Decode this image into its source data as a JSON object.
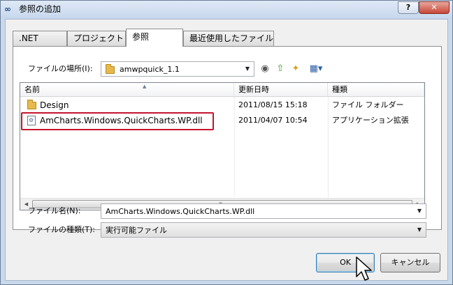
{
  "window": {
    "title": "参照の追加",
    "help_label": "?",
    "close_label": "✕"
  },
  "tabs": [
    {
      "label": ".NET",
      "active": false
    },
    {
      "label": "プロジェクト",
      "active": false
    },
    {
      "label": "参照",
      "active": true
    },
    {
      "label": "最近使用したファイル",
      "active": false
    }
  ],
  "location": {
    "label": "ファイルの場所(I):",
    "value": "amwpquick_1.1"
  },
  "toolbar_icons": [
    "back-icon",
    "up-folder-icon",
    "new-folder-icon",
    "view-menu-icon"
  ],
  "file_list": {
    "columns": [
      "名前",
      "更新日時",
      "種類"
    ],
    "rows": [
      {
        "name": "Design",
        "modified": "2011/08/15 15:18",
        "type": "ファイル フォルダー",
        "icon": "folder-icon"
      },
      {
        "name": "AmCharts.Windows.QuickCharts.WP.dll",
        "modified": "2011/04/07 10:54",
        "type": "アプリケーション拡張",
        "icon": "dll-file-icon"
      }
    ]
  },
  "filename": {
    "label": "ファイル名(N):",
    "value": "AmCharts.Windows.QuickCharts.WP.dll"
  },
  "filetype": {
    "label": "ファイルの種類(T):",
    "value": "実行可能ファイル"
  },
  "buttons": {
    "ok": "OK",
    "cancel": "キャンセル"
  },
  "colors": {
    "highlight": "#c4152c",
    "accent": "#3c7fb1"
  }
}
